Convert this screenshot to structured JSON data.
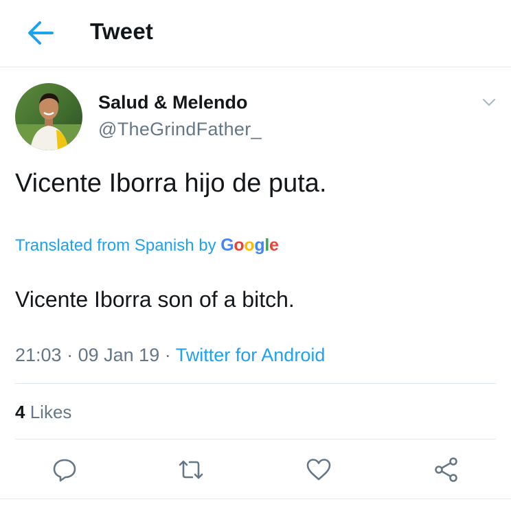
{
  "header": {
    "title": "Tweet",
    "back_icon": "arrow-left-icon"
  },
  "tweet": {
    "display_name": "Salud & Melendo",
    "handle": "@TheGrindFather_",
    "text": "Vicente Iborra hijo de puta.",
    "translation_label": "Translated from Spanish by",
    "translation_provider": [
      "G",
      "o",
      "o",
      "g",
      "l",
      "e"
    ],
    "translated_text": "Vicente Iborra son of a bitch.",
    "time": "21:03",
    "date": "09 Jan 19",
    "source": "Twitter for Android",
    "likes_count": "4",
    "likes_label": "Likes"
  },
  "actions": [
    {
      "name": "reply",
      "icon": "reply-icon"
    },
    {
      "name": "retweet",
      "icon": "retweet-icon"
    },
    {
      "name": "like",
      "icon": "heart-icon"
    },
    {
      "name": "share",
      "icon": "share-icon"
    }
  ],
  "colors": {
    "accent": "#1da1f2",
    "text_primary": "#14171a",
    "text_secondary": "#657786",
    "divider": "#e1e8ed"
  }
}
